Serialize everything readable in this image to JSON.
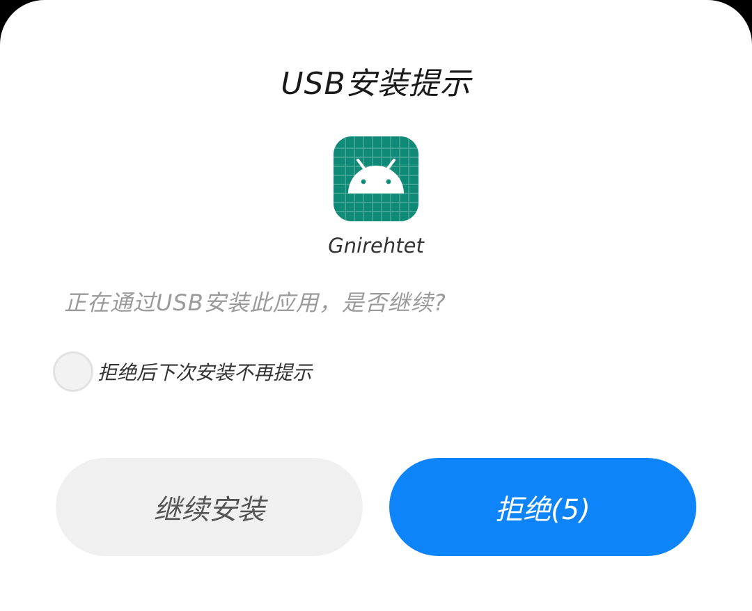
{
  "dialog": {
    "title": "USB安装提示",
    "app": {
      "name": "Gnirehtet",
      "icon": "android-app-icon",
      "icon_bg_color": "#0f8a77"
    },
    "message": "正在通过USB安装此应用，是否继续?",
    "checkbox": {
      "label": "拒绝后下次安装不再提示",
      "checked": false
    },
    "buttons": {
      "continue_label": "继续安装",
      "reject_label": "拒绝(5)"
    },
    "colors": {
      "primary": "#0d84fa",
      "secondary_button": "#f0f0f0"
    }
  }
}
